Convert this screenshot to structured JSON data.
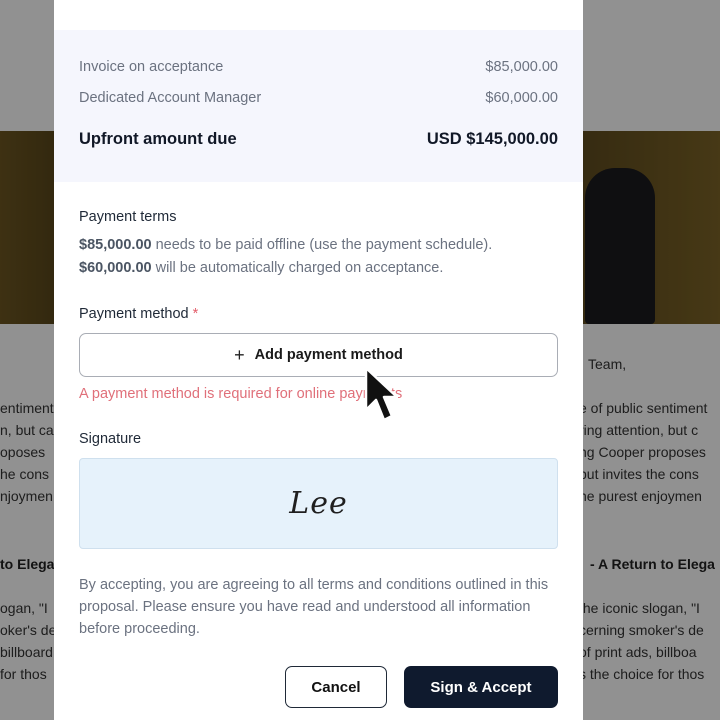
{
  "background": {
    "left_lines": [
      "entiment",
      "n, but ca",
      "oposes",
      "he cons",
      "njoymen"
    ],
    "right_lines": [
      "e of public sentiment",
      "ring attention, but c",
      "ng Cooper proposes",
      "but invites the cons",
      "he purest enjoymen"
    ],
    "team": "Team,",
    "left_heading": "to Elega",
    "right_heading": "- A Return to Elega",
    "left_lines2": [
      "ogan, \"I",
      "oker's de",
      "billboard",
      "for thos"
    ],
    "right_lines2": [
      "the iconic slogan, \"I",
      "cerning smoker's de",
      "of print ads, billboa",
      "s the choice for thos"
    ]
  },
  "summary": {
    "items": [
      {
        "label": "Invoice on acceptance",
        "amount": "$85,000.00"
      },
      {
        "label": "Dedicated Account Manager",
        "amount": "$60,000.00"
      }
    ],
    "total": {
      "label": "Upfront amount due",
      "amount": "USD $145,000.00"
    }
  },
  "payment_terms": {
    "title": "Payment terms",
    "line1_amount": "$85,000.00",
    "line1_text": " needs to be paid offline (use the payment schedule).",
    "line2_amount": "$60,000.00",
    "line2_text": " will be automatically charged on acceptance."
  },
  "payment_method": {
    "title": "Payment method",
    "required_mark": "*",
    "plus_icon": "+",
    "add_label": "Add payment method",
    "error": "A payment method is required for online payments"
  },
  "signature": {
    "title": "Signature",
    "value": "Lee"
  },
  "disclaimer": "By accepting, you are agreeing to all terms and conditions outlined in this proposal. Please ensure you have read and understood all information before proceeding.",
  "actions": {
    "cancel": "Cancel",
    "accept": "Sign & Accept"
  },
  "colors": {
    "accent": "#0f1a2e",
    "error": "#e0707a",
    "signature_bg": "#e6f2fb",
    "summary_bg": "#f5f6fd"
  }
}
